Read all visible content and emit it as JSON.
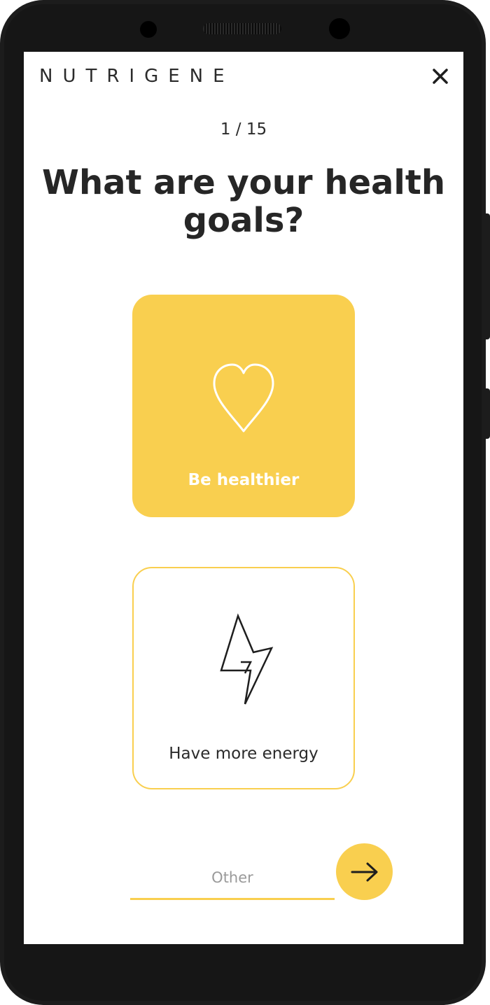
{
  "app": {
    "logo_text": "NUTRIGENE",
    "accent_color": "#f9cf4f",
    "close_icon": "close-icon"
  },
  "progress": {
    "current": 1,
    "total": 15,
    "label": "1 / 15"
  },
  "question": {
    "title": "What are your health goals?"
  },
  "options": [
    {
      "label": "Be healthier",
      "icon": "heart-icon",
      "selected": true
    },
    {
      "label": "Have more energy",
      "icon": "lightning-icon",
      "selected": false
    }
  ],
  "other_input": {
    "placeholder": "Other",
    "value": ""
  },
  "next_button": {
    "icon": "arrow-right-icon"
  }
}
